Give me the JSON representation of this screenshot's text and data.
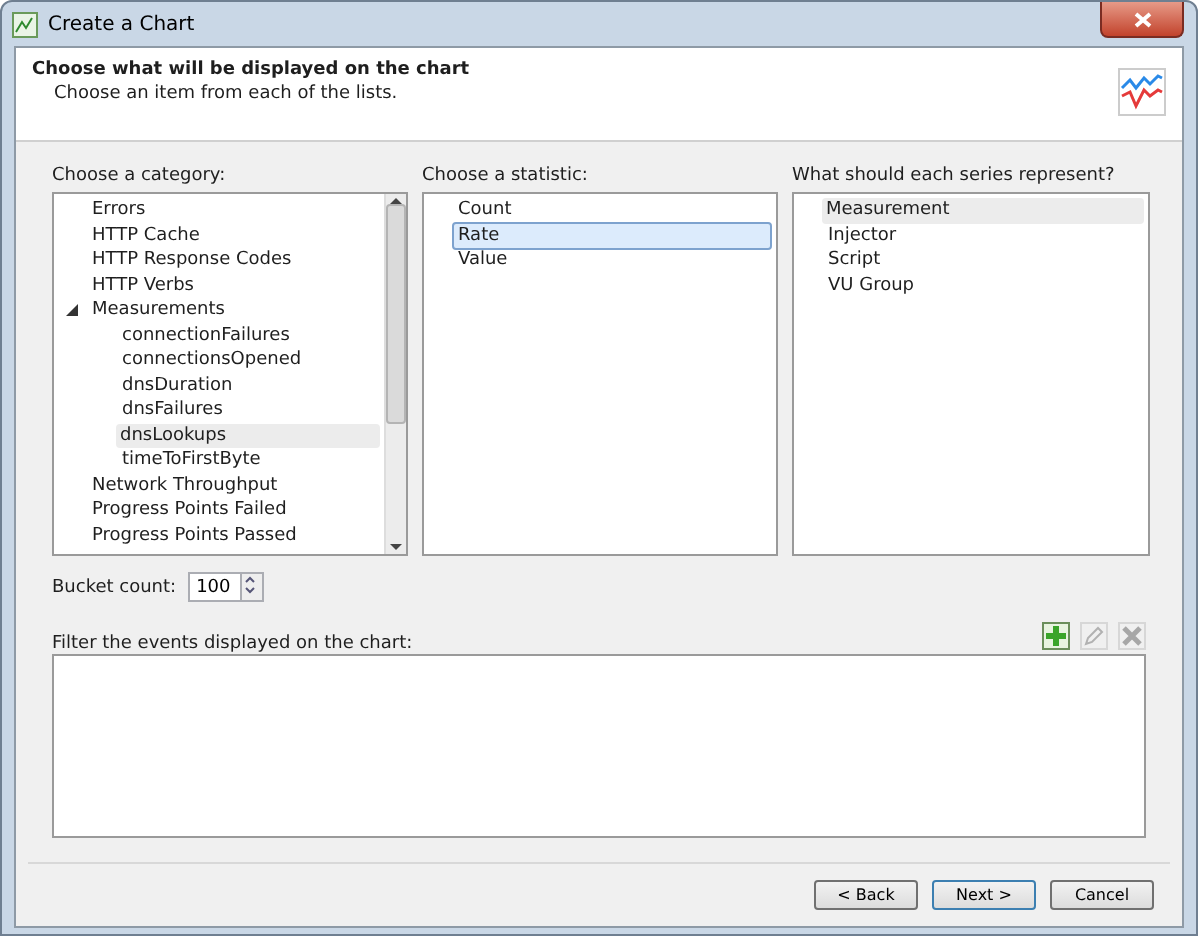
{
  "window": {
    "title": "Create a Chart"
  },
  "header": {
    "title": "Choose what will be displayed on the chart",
    "subtitle": "Choose an item from each of the lists."
  },
  "category": {
    "label": "Choose a category:",
    "items": [
      {
        "label": "Errors",
        "selected": false
      },
      {
        "label": "HTTP Cache",
        "selected": false
      },
      {
        "label": "HTTP Response Codes",
        "selected": false
      },
      {
        "label": "HTTP Verbs",
        "selected": false
      },
      {
        "label": "Measurements",
        "selected": false,
        "expanded": true,
        "children": [
          {
            "label": "connectionFailures",
            "selected": false
          },
          {
            "label": "connectionsOpened",
            "selected": false
          },
          {
            "label": "dnsDuration",
            "selected": false
          },
          {
            "label": "dnsFailures",
            "selected": false
          },
          {
            "label": "dnsLookups",
            "selected": true
          },
          {
            "label": "timeToFirstByte",
            "selected": false
          }
        ]
      },
      {
        "label": "Network Throughput",
        "selected": false
      },
      {
        "label": "Progress Points Failed",
        "selected": false
      },
      {
        "label": "Progress Points Passed",
        "selected": false
      }
    ]
  },
  "statistic": {
    "label": "Choose a statistic:",
    "items": [
      {
        "label": "Count",
        "selected": false
      },
      {
        "label": "Rate",
        "selected": true
      },
      {
        "label": "Value",
        "selected": false
      }
    ]
  },
  "series": {
    "label": "What should each series represent?",
    "items": [
      {
        "label": "Measurement",
        "selected": true
      },
      {
        "label": "Injector",
        "selected": false
      },
      {
        "label": "Script",
        "selected": false
      },
      {
        "label": "VU Group",
        "selected": false
      }
    ]
  },
  "bucket": {
    "label": "Bucket count:",
    "value": "100"
  },
  "filter": {
    "label": "Filter the events displayed on the chart:",
    "tools": [
      {
        "kind": "add",
        "disabled": false
      },
      {
        "kind": "edit",
        "disabled": true
      },
      {
        "kind": "delete",
        "disabled": true
      }
    ]
  },
  "buttons": [
    {
      "label": "< Back",
      "default": false
    },
    {
      "label": "Next >",
      "default": true
    },
    {
      "label": "Cancel",
      "default": false
    }
  ]
}
